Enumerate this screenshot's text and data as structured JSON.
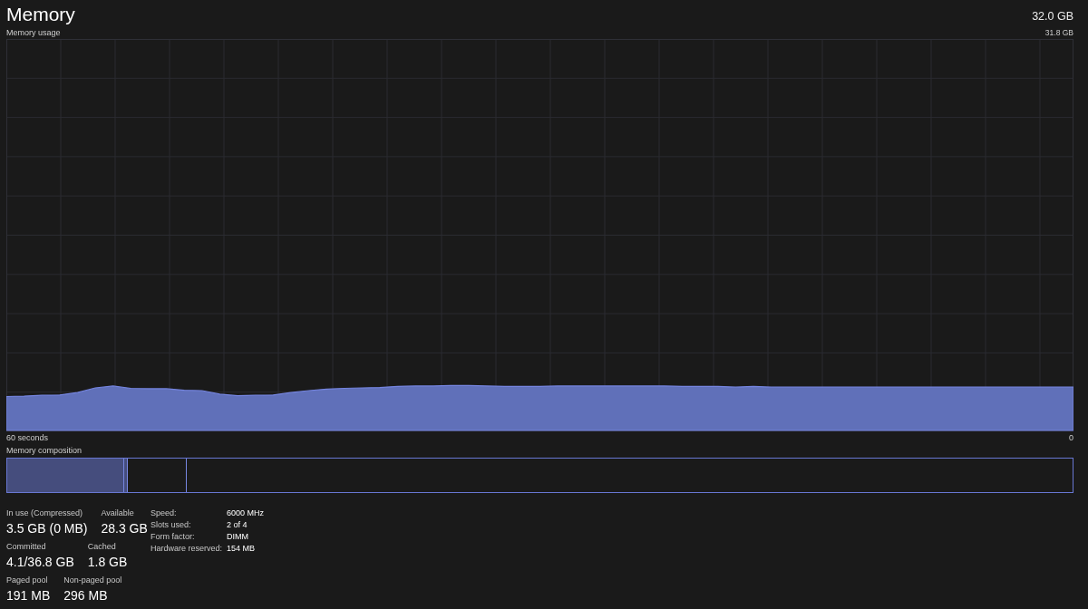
{
  "header": {
    "title": "Memory",
    "capacity": "32.0 GB"
  },
  "usage_graph": {
    "title": "Memory usage",
    "max_label": "31.8 GB",
    "start_label": "60 seconds",
    "end_label": "0"
  },
  "composition": {
    "title": "Memory composition"
  },
  "stat_rows": [
    [
      {
        "label": "In use (Compressed)",
        "value": "3.5 GB (0 MB)"
      },
      {
        "label": "Available",
        "value": "28.3 GB"
      }
    ],
    [
      {
        "label": "Committed",
        "value": "4.1/36.8 GB"
      },
      {
        "label": "Cached",
        "value": "1.8 GB"
      }
    ],
    [
      {
        "label": "Paged pool",
        "value": "191 MB"
      },
      {
        "label": "Non-paged pool",
        "value": "296 MB"
      }
    ]
  ],
  "details": [
    {
      "label": "Speed:",
      "value": "6000 MHz"
    },
    {
      "label": "Slots used:",
      "value": "2 of 4"
    },
    {
      "label": "Form factor:",
      "value": "DIMM"
    },
    {
      "label": "Hardware reserved:",
      "value": "154 MB"
    }
  ]
}
